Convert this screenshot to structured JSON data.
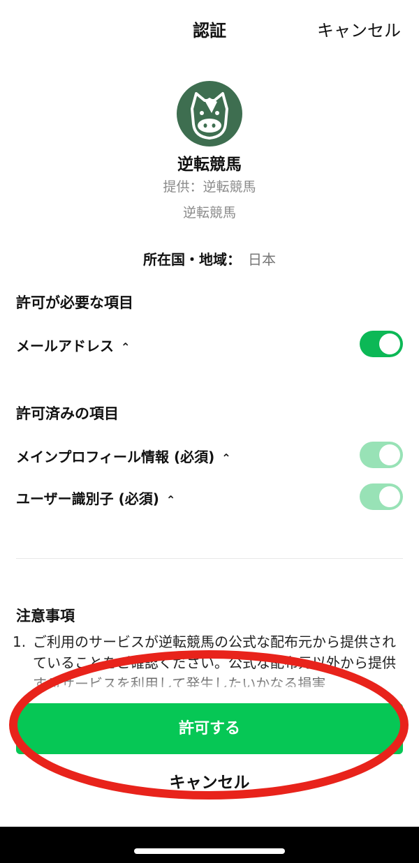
{
  "header": {
    "title": "認証",
    "cancel_label": "キャンセル"
  },
  "app": {
    "name": "逆転競馬",
    "provider": "提供：逆転競馬",
    "subtitle": "逆転競馬",
    "icon": "horse-face-icon"
  },
  "region": {
    "label": "所在国・地域：",
    "value": "日本"
  },
  "required_section": {
    "title": "許可が必要な項目",
    "items": [
      {
        "label": "メールアドレス",
        "enabled": true,
        "editable": true
      }
    ]
  },
  "granted_section": {
    "title": "許可済みの項目",
    "items": [
      {
        "label": "メインプロフィール情報 (必須)",
        "enabled": true,
        "editable": false
      },
      {
        "label": "ユーザー識別子 (必須)",
        "enabled": true,
        "editable": false
      }
    ]
  },
  "notes": {
    "title": "注意事項",
    "number": "1.",
    "text": "ご利用のサービスが逆転競馬の公式な配布元から提供されていることをご確認ください。公式な配布元以外から提供するサービスを利用して発生したいかなる損害"
  },
  "actions": {
    "allow_label": "許可する",
    "cancel_label": "キャンセル"
  },
  "colors": {
    "accent": "#06c755",
    "toggle_on": "#0cb856",
    "toggle_disabled": "#98e2b6",
    "icon_bg": "#3e6e50",
    "annotation": "#e8231b"
  }
}
